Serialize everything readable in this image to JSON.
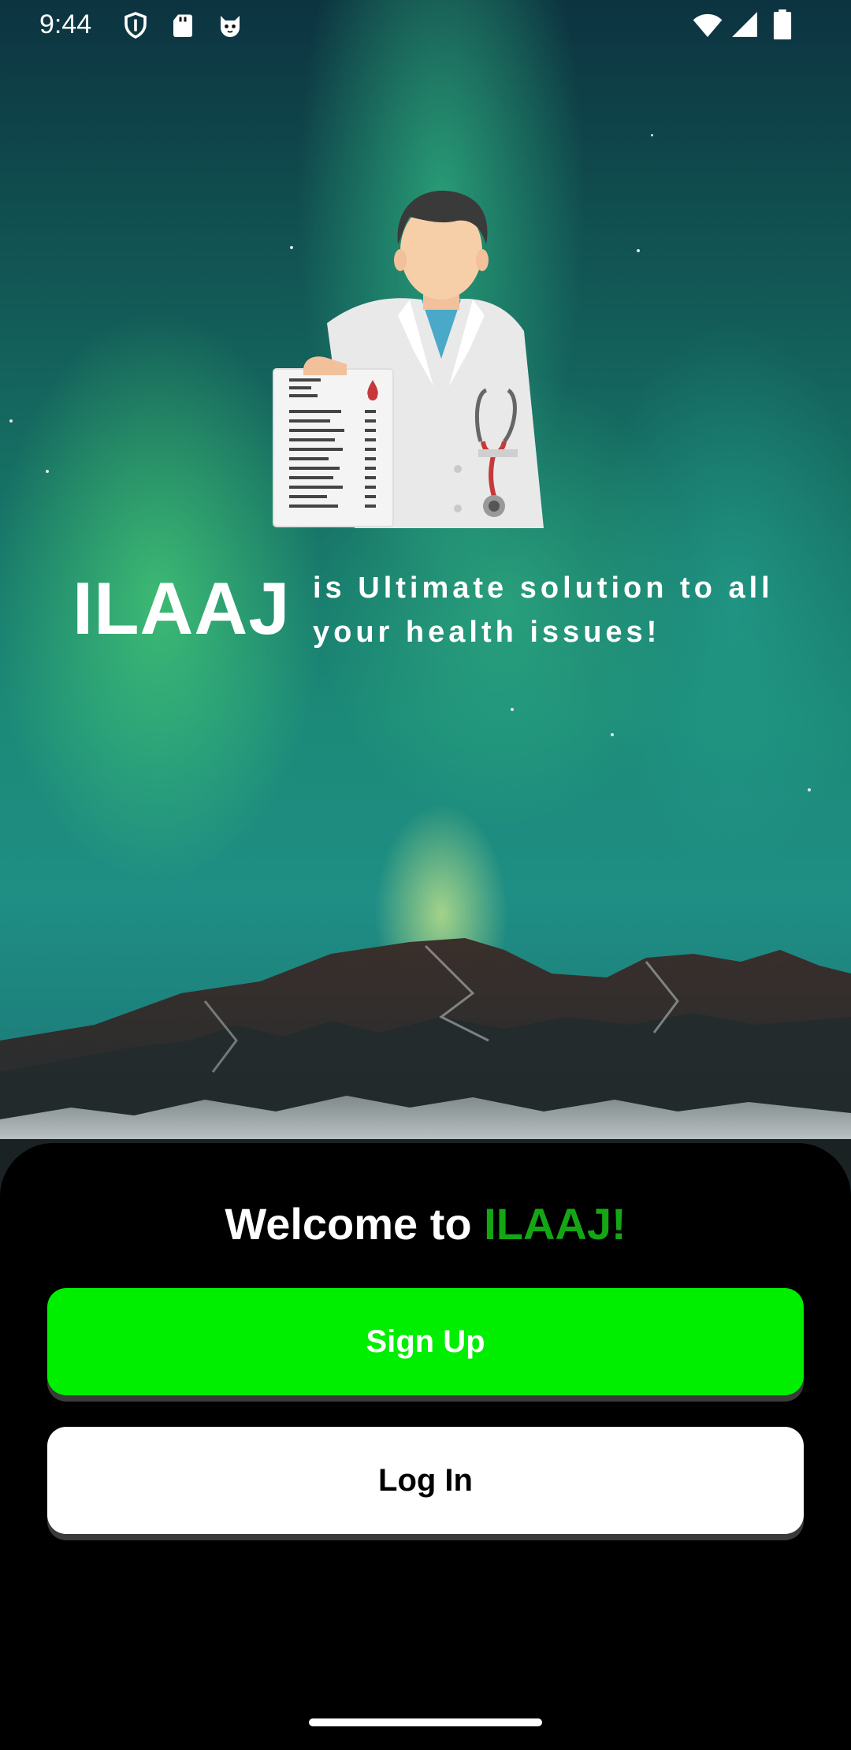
{
  "status_bar": {
    "time": "9:44",
    "icons_left": [
      "shield-icon",
      "sd-card-icon",
      "cat-face-icon"
    ],
    "icons_right": [
      "wifi-icon",
      "cell-signal-icon",
      "battery-icon"
    ]
  },
  "hero": {
    "illustration": "doctor-with-report-icon",
    "brand": "ILAAJ",
    "tagline_line1": "is Ultimate solution to all",
    "tagline_line2": "your health issues!"
  },
  "sheet": {
    "welcome_prefix": "Welcome to ",
    "welcome_brand": "ILAAJ!",
    "signup_label": "Sign Up",
    "login_label": "Log In"
  },
  "colors": {
    "accent_green": "#00ee00",
    "brand_green_text": "#14a614",
    "sheet_background": "#000000",
    "login_button": "#ffffff"
  }
}
